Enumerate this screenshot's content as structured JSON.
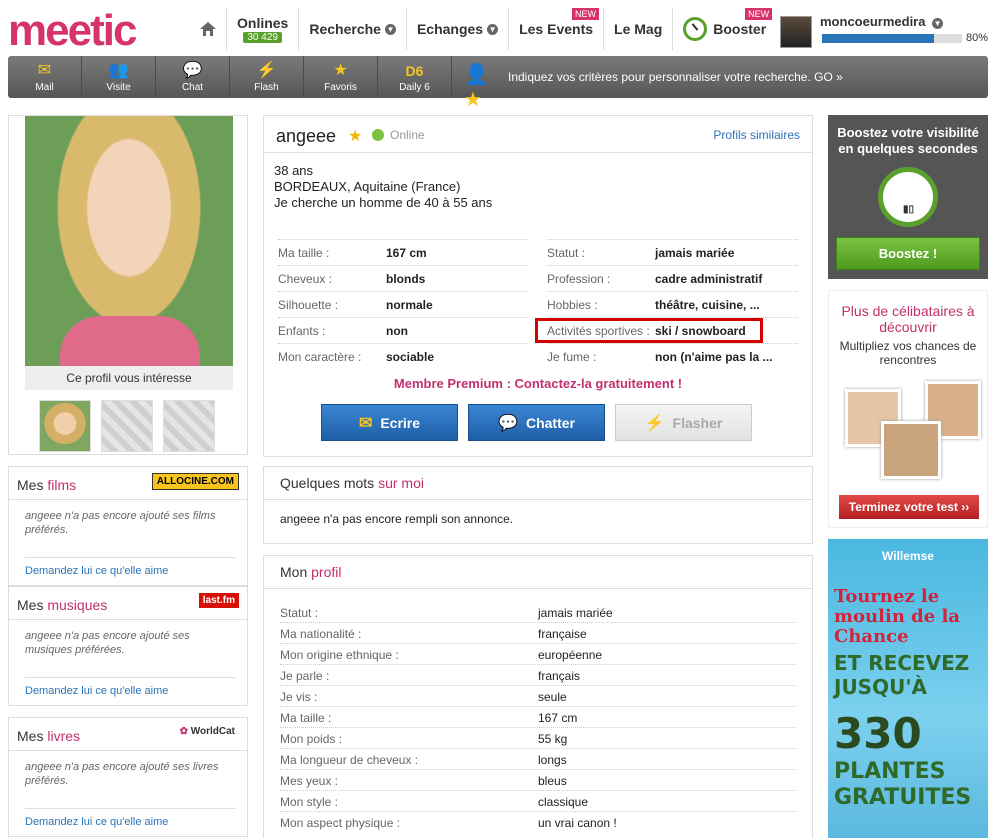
{
  "header": {
    "logo": "meetic",
    "nav": [
      {
        "label": "Onlines",
        "count": "30 429"
      },
      {
        "label": "Recherche"
      },
      {
        "label": "Echanges"
      },
      {
        "label": "Les Events",
        "badge": "NEW"
      },
      {
        "label": "Le Mag"
      },
      {
        "label": "Booster",
        "badge": "NEW"
      }
    ],
    "user": {
      "name": "moncoeurmedira",
      "progress_pct": 80,
      "progress_label": "80%"
    }
  },
  "toolbar": {
    "items": [
      "Mail",
      "Visite",
      "Chat",
      "Flash",
      "Favoris",
      "Daily 6"
    ],
    "search_prompt": "Indiquez vos critères pour personnaliser votre recherche. GO »"
  },
  "photo": {
    "interest_label": "Ce profil vous intéresse"
  },
  "profile": {
    "name": "angeee",
    "status": "Online",
    "similar_link": "Profils similaires",
    "age": "38 ans",
    "location": "BORDEAUX, Aquitaine (France)",
    "seeking": "Je cherche un homme de 40 à 55 ans",
    "attributes_left": [
      {
        "label": "Ma taille :",
        "value": "167 cm"
      },
      {
        "label": "Cheveux :",
        "value": "blonds"
      },
      {
        "label": "Silhouette :",
        "value": "normale"
      },
      {
        "label": "Enfants :",
        "value": "non"
      },
      {
        "label": "Mon caractère :",
        "value": "sociable"
      }
    ],
    "attributes_right": [
      {
        "label": "Statut :",
        "value": "jamais mariée"
      },
      {
        "label": "Profession :",
        "value": "cadre administratif"
      },
      {
        "label": "Hobbies :",
        "value": "théâtre, cuisine, ..."
      },
      {
        "label": "Activités sportives :",
        "value": "ski / snowboard"
      },
      {
        "label": "Je fume :",
        "value": "non (n'aime pas la ..."
      }
    ],
    "premium_cta": "Membre Premium : Contactez-la gratuitement !",
    "buttons": {
      "write": "Ecrire",
      "chat": "Chatter",
      "flash": "Flasher"
    }
  },
  "about": {
    "title_prefix": "Quelques mots ",
    "title_highlight": "sur moi",
    "text": "angeee n'a pas encore rempli son annonce."
  },
  "my_profile": {
    "title_prefix": "Mon ",
    "title_highlight": "profil",
    "rows": [
      {
        "label": "Statut :",
        "value": "jamais mariée"
      },
      {
        "label": "Ma nationalité :",
        "value": "française"
      },
      {
        "label": "Mon origine ethnique :",
        "value": "européenne"
      },
      {
        "label": "Je parle :",
        "value": "français"
      },
      {
        "label": "Je vis :",
        "value": "seule"
      },
      {
        "label": "Ma taille :",
        "value": "167 cm"
      },
      {
        "label": "Mon poids :",
        "value": "55 kg"
      },
      {
        "label": "Ma longueur de cheveux :",
        "value": "longs"
      },
      {
        "label": "Mes yeux :",
        "value": "bleus"
      },
      {
        "label": "Mon style :",
        "value": "classique"
      },
      {
        "label": "Mon aspect physique :",
        "value": "un vrai canon !"
      }
    ]
  },
  "side_boxes": [
    {
      "prefix": "Mes ",
      "highlight": "films",
      "brand": "ALLOCINE.COM",
      "empty": "angeee n'a pas encore ajouté ses films préférés.",
      "ask": "Demandez lui ce qu'elle aime"
    },
    {
      "prefix": "Mes ",
      "highlight": "musiques",
      "brand": "last.fm",
      "empty": "angeee n'a pas encore ajouté ses musiques préférées.",
      "ask": "Demandez lui ce qu'elle aime"
    },
    {
      "prefix": "Mes ",
      "highlight": "livres",
      "brand": "WorldCat",
      "empty": "angeee n'a pas encore ajouté ses livres préférés.",
      "ask": "Demandez lui ce qu'elle aime"
    }
  ],
  "boost": {
    "title": "Boostez votre visibilité en quelques secondes",
    "button": "Boostez !"
  },
  "celib": {
    "title": "Plus de célibataires à découvrir",
    "subtitle": "Multipliez vos chances de rencontres",
    "button": "Terminez votre test ››"
  },
  "ad": {
    "brand": "Willemse",
    "tagline": "Tournez le moulin de la Chance",
    "line1": "ET RECEVEZ",
    "line2": "JUSQU'À",
    "line3": "330",
    "line4": "PLANTES",
    "line5": "GRATUITES"
  },
  "colors": {
    "brand_pink": "#d6336c",
    "accent_blue": "#2b73b7",
    "boost_green": "#5aa02c"
  }
}
